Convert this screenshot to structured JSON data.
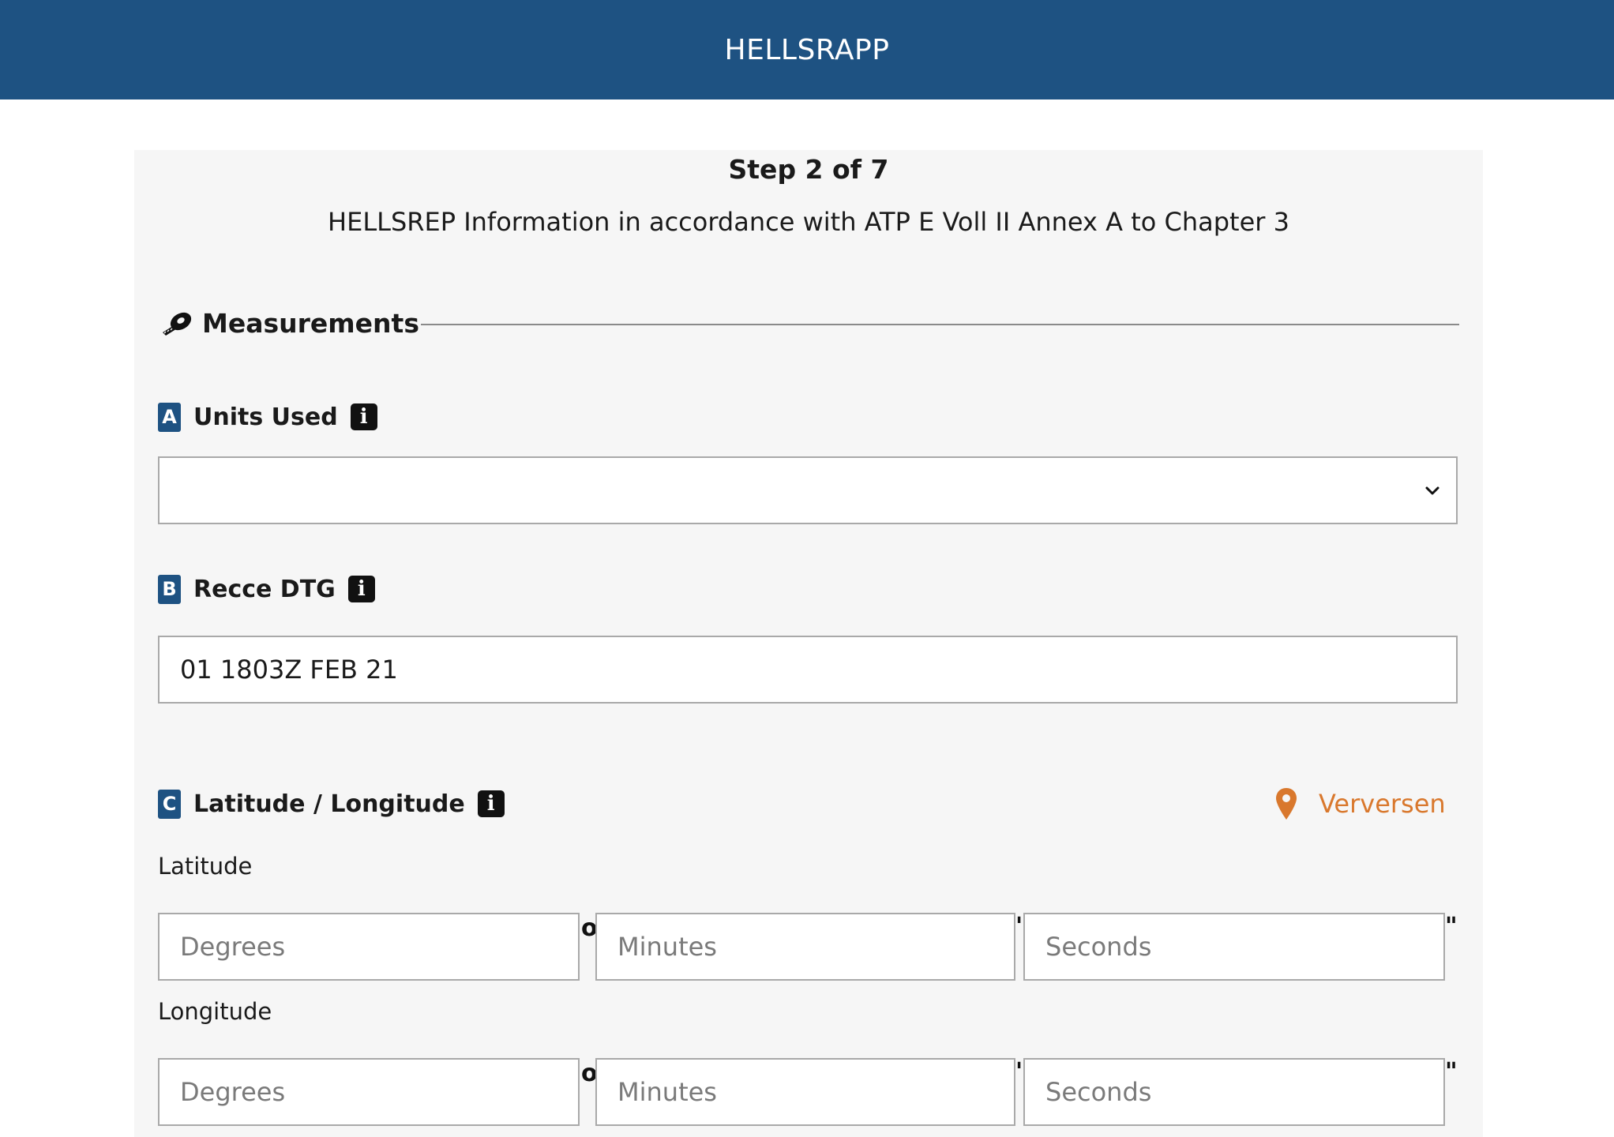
{
  "header": {
    "app_title": "HELLSRAPP"
  },
  "step": {
    "label": "Step 2 of 7"
  },
  "subtitle": "HELLSREP Information in accordance with ATP E Voll II Annex A to Chapter 3",
  "section": {
    "title": "Measurements",
    "icon": "tape-measure-icon"
  },
  "fields": {
    "units": {
      "letter": "A",
      "label": "Units Used",
      "value": ""
    },
    "recce_dtg": {
      "letter": "B",
      "label": "Recce DTG",
      "value": "01 1803Z FEB 21"
    },
    "latlon": {
      "letter": "C",
      "label": "Latitude / Longitude",
      "refresh_label": "Verversen",
      "latitude_label": "Latitude",
      "longitude_label": "Longitude",
      "degrees_placeholder": "Degrees",
      "minutes_placeholder": "Minutes",
      "seconds_placeholder": "Seconds",
      "degree_symbol": "o",
      "minute_symbol": "'",
      "second_symbol": "\""
    }
  },
  "colors": {
    "header_bg": "#1e5282",
    "badge_bg": "#1e5282",
    "accent_orange": "#d9782d",
    "panel_bg": "#f6f6f6"
  }
}
